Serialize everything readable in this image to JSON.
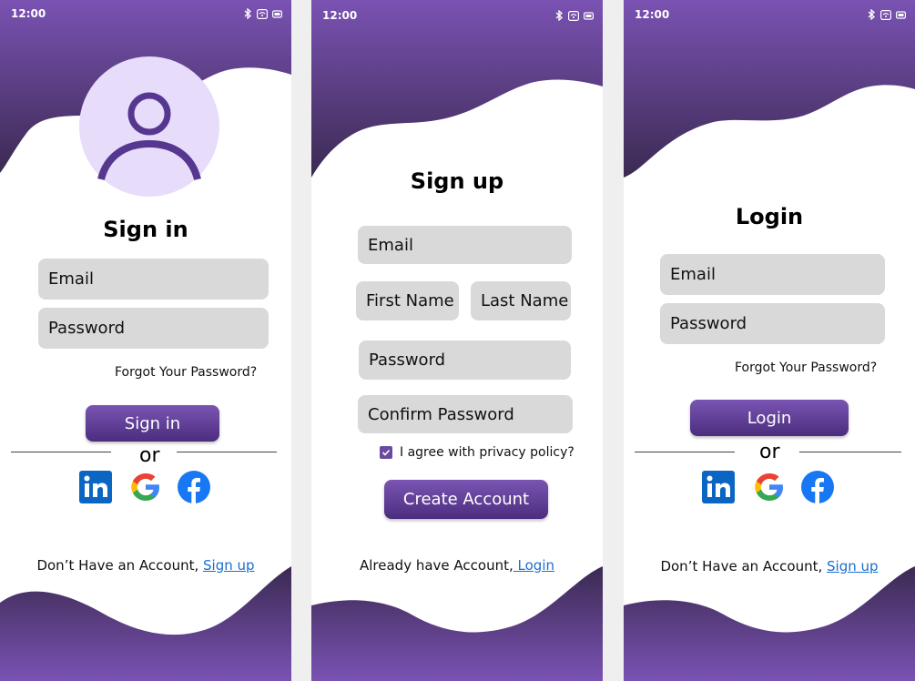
{
  "colors": {
    "wave_top": "#7a52b3",
    "wave_dark": "#3b2a52",
    "avatar_bg": "#e8dcfb",
    "avatar_icon": "#56378f",
    "field_bg": "#d9d9d9",
    "link": "#1a6fcf"
  },
  "status": {
    "time": "12:00",
    "icons": [
      "bluetooth-icon",
      "wifi-icon",
      "battery-icon"
    ]
  },
  "signin": {
    "title": "Sign in",
    "email": "Email",
    "password": "Password",
    "forgot": "Forgot Your Password?",
    "button": "Sign in",
    "or": "or",
    "footer_text": "Don’t Have an Account, ",
    "footer_link": "Sign up"
  },
  "signup": {
    "title": "Sign up",
    "email": "Email",
    "first_name": "First Name",
    "last_name": "Last Name",
    "password": "Password",
    "confirm_password": "Confirm Password",
    "privacy": "I agree with privacy policy?",
    "privacy_checked": true,
    "button": "Create Account",
    "footer_text": "Already have Account,",
    "footer_link": " Login"
  },
  "login": {
    "title": "Login",
    "email": "Email",
    "password": "Password",
    "forgot": "Forgot Your Password?",
    "button": "Login",
    "or": "or",
    "footer_text": "Don’t Have an Account, ",
    "footer_link": "Sign up"
  },
  "social": [
    "linkedin-icon",
    "google-icon",
    "facebook-icon"
  ]
}
